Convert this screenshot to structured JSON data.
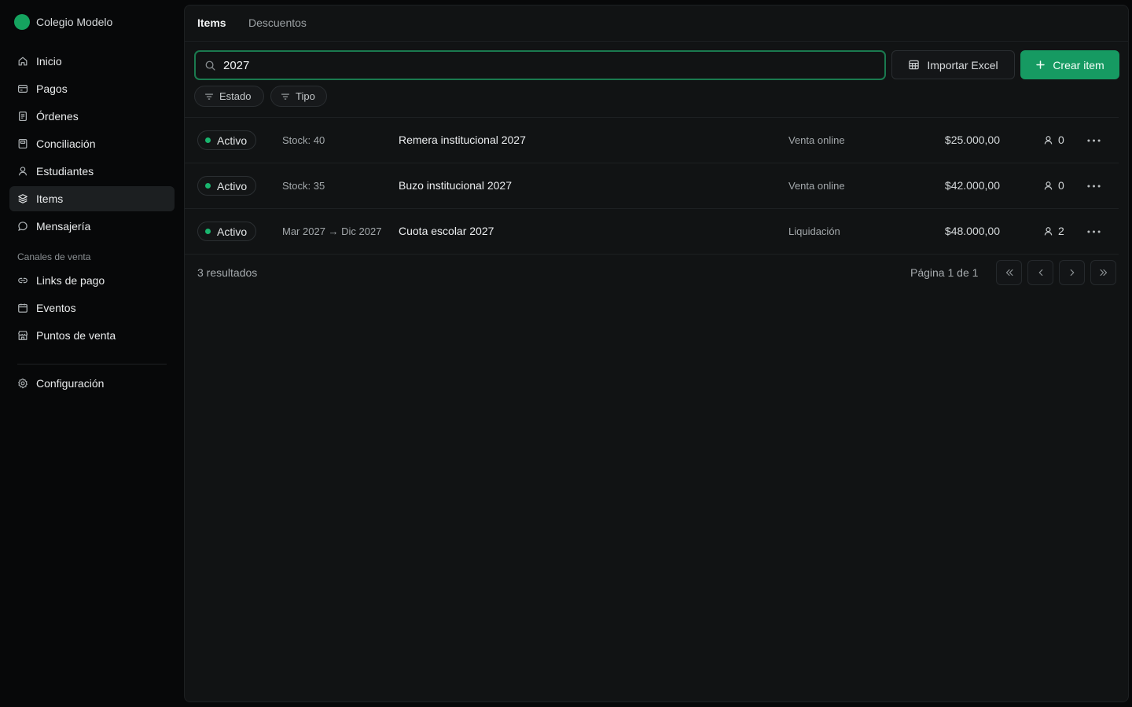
{
  "org": {
    "name": "Colegio Modelo"
  },
  "sidebar": {
    "items": [
      {
        "label": "Inicio",
        "icon": "home-icon"
      },
      {
        "label": "Pagos",
        "icon": "card-icon"
      },
      {
        "label": "Órdenes",
        "icon": "receipt-icon"
      },
      {
        "label": "Conciliación",
        "icon": "reconcile-icon"
      },
      {
        "label": "Estudiantes",
        "icon": "user-icon"
      },
      {
        "label": "Items",
        "icon": "layers-icon",
        "active": true
      },
      {
        "label": "Mensajería",
        "icon": "chat-icon"
      }
    ],
    "section_label": "Canales de venta",
    "channel_items": [
      {
        "label": "Links de pago",
        "icon": "link-icon"
      },
      {
        "label": "Eventos",
        "icon": "calendar-icon"
      },
      {
        "label": "Puntos de venta",
        "icon": "store-icon"
      }
    ],
    "settings": {
      "label": "Configuración",
      "icon": "gear-icon"
    }
  },
  "tabs": [
    {
      "label": "Items",
      "active": true
    },
    {
      "label": "Descuentos",
      "active": false
    }
  ],
  "search": {
    "value": "2027",
    "placeholder": ""
  },
  "toolbar": {
    "import_label": "Importar Excel",
    "create_label": "Crear item"
  },
  "filters": [
    {
      "label": "Estado"
    },
    {
      "label": "Tipo"
    }
  ],
  "rows": [
    {
      "status": "Activo",
      "stock": "Stock: 40",
      "name": "Remera institucional 2027",
      "channel": "Venta online",
      "price": "$25.000,00",
      "users": "0"
    },
    {
      "status": "Activo",
      "stock": "Stock: 35",
      "name": "Buzo institucional 2027",
      "channel": "Venta online",
      "price": "$42.000,00",
      "users": "0"
    },
    {
      "status": "Activo",
      "stock": "Mar 2027 → Dic 2027",
      "name": "Cuota escolar 2027",
      "channel": "Liquidación",
      "price": "$48.000,00",
      "users": "2"
    }
  ],
  "footer": {
    "results": "3 resultados",
    "page_info": "Página 1 de 1"
  },
  "colors": {
    "accent": "#169a62",
    "status_dot": "#19b56e",
    "background": "#070809",
    "panel": "#111314"
  }
}
